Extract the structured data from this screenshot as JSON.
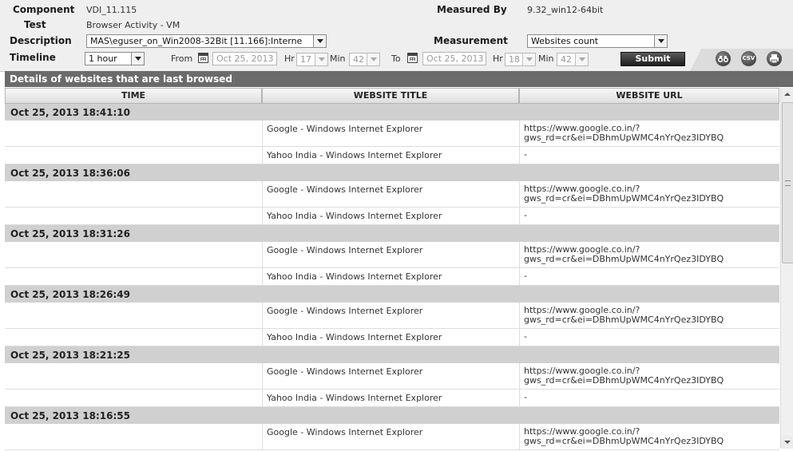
{
  "header": {
    "component_label": "Component",
    "component_value": "VDI_11.115",
    "test_label": "Test",
    "test_value": "Browser Activity - VM",
    "description_label": "Description",
    "description_value": "MAS\\eguser_on_Win2008-32Bit [11.166]:Interne",
    "measured_by_label": "Measured By",
    "measured_by_value": "9.32_win12-64bit",
    "measurement_label": "Measurement",
    "measurement_value": "Websites count",
    "timeline_label": "Timeline",
    "timeline_value": "1 hour",
    "from_label": "From",
    "from_date": "Oct 25, 2013",
    "from_hr_label": "Hr",
    "from_hr": "17",
    "from_min_label": "Min",
    "from_min": "42",
    "to_label": "To",
    "to_date": "Oct 25, 2013",
    "to_hr_label": "Hr",
    "to_hr": "18",
    "to_min_label": "Min",
    "to_min": "42",
    "submit_label": "Submit"
  },
  "toolbar": {
    "icons": [
      "binoculars-icon",
      "csv-icon",
      "printer-icon"
    ],
    "csv_text": "CSV"
  },
  "section_title": "Details of websites that are last browsed",
  "table": {
    "columns": [
      "TIME",
      "WEBSITE TITLE",
      "WEBSITE URL"
    ],
    "groups": [
      {
        "time": "Oct 25, 2013 18:41:10",
        "rows": [
          {
            "title": "Google - Windows Internet Explorer",
            "url_line1": "https://www.google.co.in/?",
            "url_line2": "gws_rd=cr&ei=DBhmUpWMC4nYrQez3IDYBQ"
          },
          {
            "title": "Yahoo India - Windows Internet Explorer",
            "url": "-"
          }
        ]
      },
      {
        "time": "Oct 25, 2013 18:36:06",
        "rows": [
          {
            "title": "Google - Windows Internet Explorer",
            "url_line1": "https://www.google.co.in/?",
            "url_line2": "gws_rd=cr&ei=DBhmUpWMC4nYrQez3IDYBQ"
          },
          {
            "title": "Yahoo India - Windows Internet Explorer",
            "url": "-"
          }
        ]
      },
      {
        "time": "Oct 25, 2013 18:31:26",
        "rows": [
          {
            "title": "Google - Windows Internet Explorer",
            "url_line1": "https://www.google.co.in/?",
            "url_line2": "gws_rd=cr&ei=DBhmUpWMC4nYrQez3IDYBQ"
          },
          {
            "title": "Yahoo India - Windows Internet Explorer",
            "url": "-"
          }
        ]
      },
      {
        "time": "Oct 25, 2013 18:26:49",
        "rows": [
          {
            "title": "Google - Windows Internet Explorer",
            "url_line1": "https://www.google.co.in/?",
            "url_line2": "gws_rd=cr&ei=DBhmUpWMC4nYrQez3IDYBQ"
          },
          {
            "title": "Yahoo India - Windows Internet Explorer",
            "url": "-"
          }
        ]
      },
      {
        "time": "Oct 25, 2013 18:21:25",
        "rows": [
          {
            "title": "Google - Windows Internet Explorer",
            "url_line1": "https://www.google.co.in/?",
            "url_line2": "gws_rd=cr&ei=DBhmUpWMC4nYrQez3IDYBQ"
          },
          {
            "title": "Yahoo India - Windows Internet Explorer",
            "url": "-"
          }
        ]
      },
      {
        "time": "Oct 25, 2013 18:16:55",
        "rows": [
          {
            "title": "Google - Windows Internet Explorer",
            "url_line1": "https://www.google.co.in/?",
            "url_line2": "gws_rd=cr&ei=DBhmUpWMC4nYrQez3IDYBQ"
          }
        ]
      }
    ]
  }
}
